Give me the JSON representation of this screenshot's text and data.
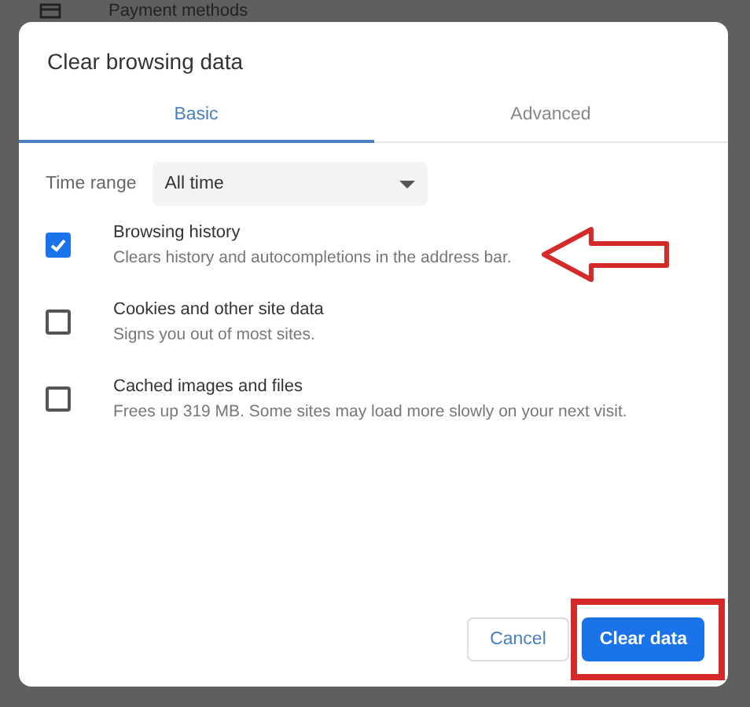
{
  "background": {
    "row_label": "Payment methods"
  },
  "dialog": {
    "title": "Clear browsing data",
    "tabs": [
      {
        "label": "Basic",
        "selected": true
      },
      {
        "label": "Advanced",
        "selected": false
      }
    ],
    "time_range": {
      "label": "Time range",
      "value": "All time"
    },
    "items": [
      {
        "title": "Browsing history",
        "description": "Clears history and autocompletions in the address bar.",
        "checked": true
      },
      {
        "title": "Cookies and other site data",
        "description": "Signs you out of most sites.",
        "checked": false
      },
      {
        "title": "Cached images and files",
        "description": "Frees up 319 MB. Some sites may load more slowly on your next visit.",
        "checked": false
      }
    ],
    "buttons": [
      {
        "label": "Cancel",
        "kind": "secondary"
      },
      {
        "label": "Clear data",
        "kind": "primary"
      }
    ]
  }
}
